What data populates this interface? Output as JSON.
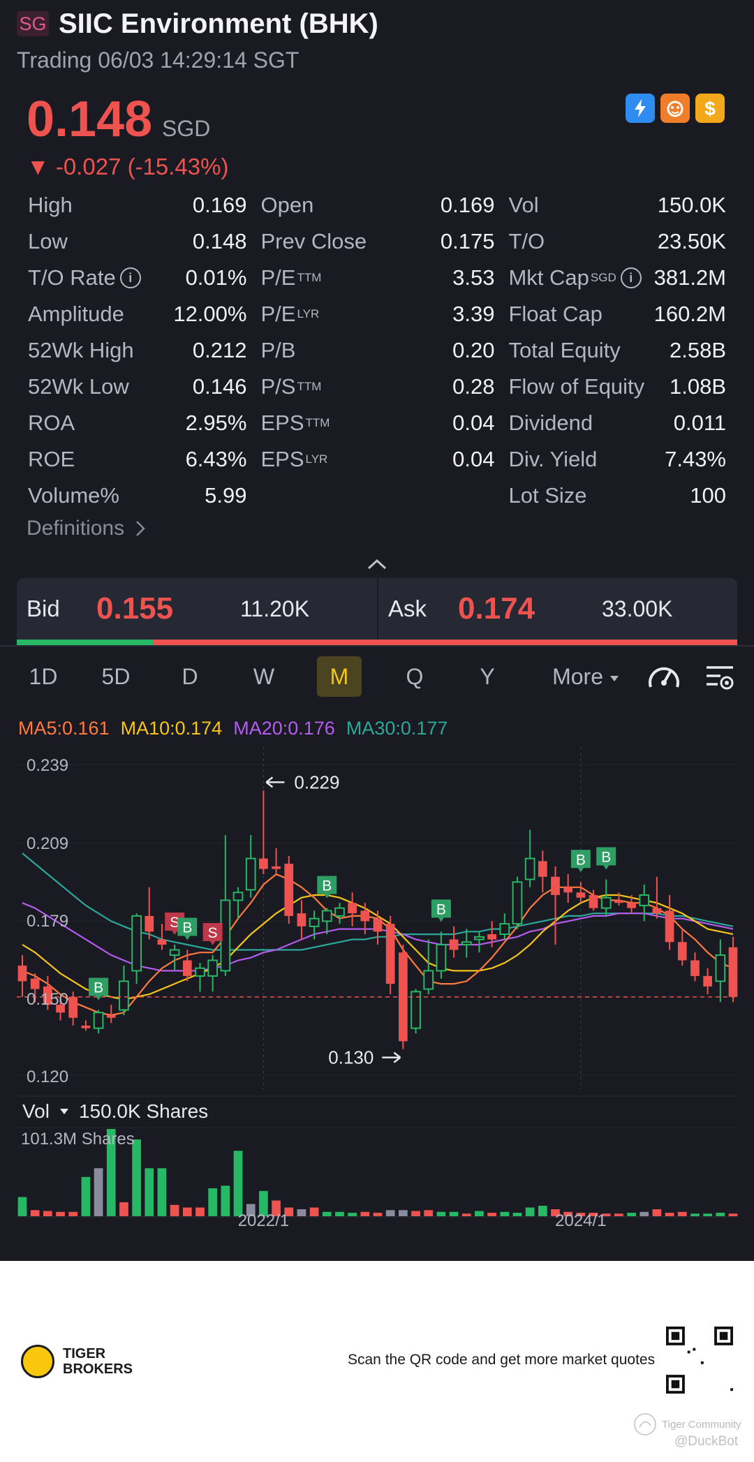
{
  "header": {
    "market_badge": "SG",
    "title": "SIIC Environment (BHK)",
    "status": "Trading 06/03 14:29:14 SGT",
    "price": "0.148",
    "currency": "SGD",
    "change": "▼ -0.027 (-15.43%)",
    "badge_icons": [
      "lightning-icon",
      "tiger-icon",
      "dollar-icon"
    ]
  },
  "stats": {
    "rows": [
      [
        {
          "label": "High",
          "value": "0.169"
        },
        {
          "label": "Open",
          "value": "0.169"
        },
        {
          "label": "Vol",
          "value": "150.0K"
        }
      ],
      [
        {
          "label": "Low",
          "value": "0.148"
        },
        {
          "label": "Prev Close",
          "value": "0.175"
        },
        {
          "label": "T/O",
          "value": "23.50K"
        }
      ],
      [
        {
          "label": "T/O Rate",
          "value": "0.01%",
          "info": true
        },
        {
          "label": "P/E",
          "sup": "TTM",
          "value": "3.53"
        },
        {
          "label": "Mkt Cap",
          "sup": "SGD",
          "value": "381.2M",
          "info": true
        }
      ],
      [
        {
          "label": "Amplitude",
          "value": "12.00%"
        },
        {
          "label": "P/E",
          "sup": "LYR",
          "value": "3.39"
        },
        {
          "label": "Float Cap",
          "value": "160.2M"
        }
      ],
      [
        {
          "label": "52Wk High",
          "value": "0.212"
        },
        {
          "label": "P/B",
          "value": "0.20"
        },
        {
          "label": "Total Equity",
          "value": "2.58B"
        }
      ],
      [
        {
          "label": "52Wk Low",
          "value": "0.146"
        },
        {
          "label": "P/S",
          "sup": "TTM",
          "value": "0.28"
        },
        {
          "label": "Flow of Equity",
          "value": "1.08B"
        }
      ],
      [
        {
          "label": "ROA",
          "value": "2.95%"
        },
        {
          "label": "EPS",
          "sup": "TTM",
          "value": "0.04"
        },
        {
          "label": "Dividend",
          "value": "0.011"
        }
      ],
      [
        {
          "label": "ROE",
          "value": "6.43%"
        },
        {
          "label": "EPS",
          "sup": "LYR",
          "value": "0.04"
        },
        {
          "label": "Div. Yield",
          "value": "7.43%"
        }
      ],
      [
        {
          "label": "Volume%",
          "value": "5.99"
        },
        {
          "label": "",
          "value": ""
        },
        {
          "label": "Lot Size",
          "value": "100"
        }
      ]
    ],
    "definitions_label": "Definitions"
  },
  "bid_ask": {
    "bid_label": "Bid",
    "bid_price": "0.155",
    "bid_size": "11.20K",
    "ask_label": "Ask",
    "ask_price": "0.174",
    "ask_size": "33.00K",
    "bid_ratio": 0.19
  },
  "tabs": {
    "items": [
      "1D",
      "5D",
      "D",
      "W",
      "M",
      "Q",
      "Y"
    ],
    "active": "M",
    "more_label": "More"
  },
  "ma_legend": [
    {
      "label": "MA5:0.161",
      "color": "#ff7a3d"
    },
    {
      "label": "MA10:0.174",
      "color": "#f5c518"
    },
    {
      "label": "MA20:0.176",
      "color": "#b45cf0"
    },
    {
      "label": "MA30:0.177",
      "color": "#2aa89a"
    }
  ],
  "chart": {
    "y_ticks": [
      "0.239",
      "0.209",
      "0.179",
      "0.150",
      "0.120"
    ],
    "max_label": "0.229",
    "min_label": "0.130",
    "x_ticks": [
      "2022/1",
      "2024/1"
    ],
    "vol_label": "Vol",
    "vol_current": "150.0K Shares",
    "vol_max": "101.3M Shares",
    "up_color": "#26b865",
    "down_color": "#ef5350",
    "buy_marker": "B",
    "sell_marker": "S"
  },
  "chart_data": {
    "type": "candlestick",
    "price_range": [
      0.12,
      0.239
    ],
    "last_price": 0.15,
    "candles": [
      {
        "o": 0.162,
        "h": 0.166,
        "l": 0.15,
        "c": 0.156
      },
      {
        "o": 0.157,
        "h": 0.159,
        "l": 0.148,
        "c": 0.153
      },
      {
        "o": 0.154,
        "h": 0.158,
        "l": 0.145,
        "c": 0.147
      },
      {
        "o": 0.147,
        "h": 0.15,
        "l": 0.141,
        "c": 0.144
      },
      {
        "o": 0.15,
        "h": 0.152,
        "l": 0.139,
        "c": 0.142
      },
      {
        "o": 0.139,
        "h": 0.141,
        "l": 0.137,
        "c": 0.138
      },
      {
        "o": 0.138,
        "h": 0.145,
        "l": 0.136,
        "c": 0.144
      },
      {
        "o": 0.143,
        "h": 0.147,
        "l": 0.14,
        "c": 0.142
      },
      {
        "o": 0.145,
        "h": 0.162,
        "l": 0.143,
        "c": 0.156
      },
      {
        "o": 0.16,
        "h": 0.182,
        "l": 0.155,
        "c": 0.181
      },
      {
        "o": 0.181,
        "h": 0.192,
        "l": 0.172,
        "c": 0.175
      },
      {
        "o": 0.172,
        "h": 0.178,
        "l": 0.168,
        "c": 0.17
      },
      {
        "o": 0.166,
        "h": 0.17,
        "l": 0.16,
        "c": 0.168
      },
      {
        "o": 0.164,
        "h": 0.168,
        "l": 0.156,
        "c": 0.158
      },
      {
        "o": 0.158,
        "h": 0.163,
        "l": 0.152,
        "c": 0.161
      },
      {
        "o": 0.158,
        "h": 0.166,
        "l": 0.152,
        "c": 0.164
      },
      {
        "o": 0.16,
        "h": 0.212,
        "l": 0.158,
        "c": 0.187
      },
      {
        "o": 0.187,
        "h": 0.192,
        "l": 0.18,
        "c": 0.19
      },
      {
        "o": 0.191,
        "h": 0.212,
        "l": 0.188,
        "c": 0.203
      },
      {
        "o": 0.203,
        "h": 0.229,
        "l": 0.197,
        "c": 0.199
      },
      {
        "o": 0.2,
        "h": 0.207,
        "l": 0.197,
        "c": 0.199
      },
      {
        "o": 0.201,
        "h": 0.204,
        "l": 0.178,
        "c": 0.181
      },
      {
        "o": 0.182,
        "h": 0.187,
        "l": 0.172,
        "c": 0.177
      },
      {
        "o": 0.177,
        "h": 0.183,
        "l": 0.172,
        "c": 0.18
      },
      {
        "o": 0.179,
        "h": 0.184,
        "l": 0.174,
        "c": 0.183
      },
      {
        "o": 0.181,
        "h": 0.186,
        "l": 0.178,
        "c": 0.184
      },
      {
        "o": 0.186,
        "h": 0.19,
        "l": 0.177,
        "c": 0.182
      },
      {
        "o": 0.183,
        "h": 0.186,
        "l": 0.174,
        "c": 0.179
      },
      {
        "o": 0.18,
        "h": 0.183,
        "l": 0.17,
        "c": 0.175
      },
      {
        "o": 0.178,
        "h": 0.181,
        "l": 0.151,
        "c": 0.155
      },
      {
        "o": 0.167,
        "h": 0.17,
        "l": 0.13,
        "c": 0.133
      },
      {
        "o": 0.138,
        "h": 0.153,
        "l": 0.136,
        "c": 0.152
      },
      {
        "o": 0.153,
        "h": 0.172,
        "l": 0.151,
        "c": 0.16
      },
      {
        "o": 0.16,
        "h": 0.175,
        "l": 0.157,
        "c": 0.17
      },
      {
        "o": 0.172,
        "h": 0.177,
        "l": 0.165,
        "c": 0.168
      },
      {
        "o": 0.17,
        "h": 0.176,
        "l": 0.165,
        "c": 0.171
      },
      {
        "o": 0.172,
        "h": 0.175,
        "l": 0.167,
        "c": 0.173
      },
      {
        "o": 0.174,
        "h": 0.179,
        "l": 0.169,
        "c": 0.172
      },
      {
        "o": 0.174,
        "h": 0.182,
        "l": 0.172,
        "c": 0.178
      },
      {
        "o": 0.178,
        "h": 0.196,
        "l": 0.176,
        "c": 0.194
      },
      {
        "o": 0.195,
        "h": 0.214,
        "l": 0.192,
        "c": 0.203
      },
      {
        "o": 0.202,
        "h": 0.206,
        "l": 0.19,
        "c": 0.196
      },
      {
        "o": 0.196,
        "h": 0.2,
        "l": 0.17,
        "c": 0.189
      },
      {
        "o": 0.192,
        "h": 0.197,
        "l": 0.186,
        "c": 0.19
      },
      {
        "o": 0.19,
        "h": 0.194,
        "l": 0.186,
        "c": 0.188
      },
      {
        "o": 0.189,
        "h": 0.191,
        "l": 0.183,
        "c": 0.184
      },
      {
        "o": 0.184,
        "h": 0.195,
        "l": 0.181,
        "c": 0.188
      },
      {
        "o": 0.187,
        "h": 0.19,
        "l": 0.185,
        "c": 0.186
      },
      {
        "o": 0.186,
        "h": 0.189,
        "l": 0.182,
        "c": 0.184
      },
      {
        "o": 0.185,
        "h": 0.193,
        "l": 0.179,
        "c": 0.189
      },
      {
        "o": 0.184,
        "h": 0.196,
        "l": 0.18,
        "c": 0.182
      },
      {
        "o": 0.183,
        "h": 0.189,
        "l": 0.168,
        "c": 0.171
      },
      {
        "o": 0.171,
        "h": 0.176,
        "l": 0.162,
        "c": 0.164
      },
      {
        "o": 0.164,
        "h": 0.167,
        "l": 0.156,
        "c": 0.158
      },
      {
        "o": 0.158,
        "h": 0.161,
        "l": 0.151,
        "c": 0.154
      },
      {
        "o": 0.156,
        "h": 0.172,
        "l": 0.148,
        "c": 0.166
      },
      {
        "o": 0.169,
        "h": 0.173,
        "l": 0.148,
        "c": 0.15
      }
    ],
    "signals": [
      {
        "i": 6,
        "type": "B"
      },
      {
        "i": 12,
        "type": "S"
      },
      {
        "i": 13,
        "type": "B"
      },
      {
        "i": 15,
        "type": "S"
      },
      {
        "i": 24,
        "type": "B"
      },
      {
        "i": 33,
        "type": "B"
      },
      {
        "i": 44,
        "type": "B"
      },
      {
        "i": 46,
        "type": "B"
      }
    ],
    "ma5": [
      0.16,
      0.158,
      0.155,
      0.151,
      0.148,
      0.146,
      0.144,
      0.143,
      0.144,
      0.15,
      0.156,
      0.161,
      0.164,
      0.166,
      0.167,
      0.167,
      0.173,
      0.18,
      0.186,
      0.193,
      0.197,
      0.195,
      0.192,
      0.188,
      0.183,
      0.18,
      0.181,
      0.181,
      0.18,
      0.176,
      0.168,
      0.162,
      0.156,
      0.155,
      0.155,
      0.156,
      0.16,
      0.165,
      0.171,
      0.177,
      0.184,
      0.189,
      0.192,
      0.192,
      0.192,
      0.189,
      0.187,
      0.187,
      0.186,
      0.186,
      0.184,
      0.181,
      0.176,
      0.172,
      0.167,
      0.163,
      0.161
    ],
    "ma10": [
      0.17,
      0.167,
      0.163,
      0.159,
      0.156,
      0.153,
      0.151,
      0.15,
      0.149,
      0.15,
      0.151,
      0.153,
      0.155,
      0.157,
      0.159,
      0.161,
      0.164,
      0.169,
      0.174,
      0.178,
      0.182,
      0.185,
      0.188,
      0.189,
      0.189,
      0.188,
      0.186,
      0.184,
      0.181,
      0.178,
      0.173,
      0.168,
      0.163,
      0.161,
      0.16,
      0.16,
      0.16,
      0.161,
      0.163,
      0.166,
      0.17,
      0.175,
      0.179,
      0.183,
      0.186,
      0.188,
      0.189,
      0.189,
      0.188,
      0.187,
      0.186,
      0.184,
      0.182,
      0.179,
      0.176,
      0.175,
      0.174
    ],
    "ma20": [
      0.186,
      0.184,
      0.181,
      0.178,
      0.175,
      0.172,
      0.169,
      0.166,
      0.164,
      0.162,
      0.161,
      0.16,
      0.16,
      0.16,
      0.16,
      0.161,
      0.162,
      0.164,
      0.165,
      0.167,
      0.168,
      0.17,
      0.172,
      0.174,
      0.175,
      0.176,
      0.176,
      0.176,
      0.176,
      0.175,
      0.174,
      0.172,
      0.171,
      0.17,
      0.17,
      0.17,
      0.17,
      0.171,
      0.172,
      0.173,
      0.175,
      0.176,
      0.178,
      0.179,
      0.18,
      0.181,
      0.181,
      0.182,
      0.182,
      0.182,
      0.181,
      0.18,
      0.18,
      0.179,
      0.178,
      0.177,
      0.176
    ],
    "ma30": [
      0.205,
      0.201,
      0.197,
      0.193,
      0.189,
      0.185,
      0.182,
      0.179,
      0.177,
      0.175,
      0.174,
      0.172,
      0.171,
      0.17,
      0.169,
      0.168,
      0.168,
      0.168,
      0.168,
      0.168,
      0.168,
      0.168,
      0.168,
      0.169,
      0.17,
      0.171,
      0.172,
      0.172,
      0.173,
      0.173,
      0.174,
      0.174,
      0.174,
      0.174,
      0.174,
      0.175,
      0.175,
      0.176,
      0.176,
      0.177,
      0.178,
      0.179,
      0.18,
      0.181,
      0.181,
      0.182,
      0.182,
      0.182,
      0.182,
      0.182,
      0.182,
      0.181,
      0.181,
      0.18,
      0.179,
      0.178,
      0.177
    ],
    "volume_max_label": "101.3M Shares",
    "volumes": [
      0.22,
      0.07,
      0.06,
      0.05,
      0.05,
      0.45,
      0.55,
      1.0,
      0.16,
      0.88,
      0.55,
      0.55,
      0.13,
      0.1,
      0.1,
      0.32,
      0.35,
      0.75,
      0.14,
      0.29,
      0.18,
      0.1,
      0.08,
      0.1,
      0.05,
      0.05,
      0.04,
      0.05,
      0.04,
      0.07,
      0.07,
      0.06,
      0.07,
      0.05,
      0.05,
      0.03,
      0.06,
      0.04,
      0.05,
      0.04,
      0.1,
      0.12,
      0.08,
      0.05,
      0.04,
      0.04,
      0.03,
      0.03,
      0.04,
      0.05,
      0.08,
      0.04,
      0.05,
      0.03,
      0.03,
      0.04,
      0.03
    ],
    "volume_dir": [
      "up",
      "down",
      "down",
      "down",
      "down",
      "up",
      "flat",
      "up",
      "down",
      "up",
      "up",
      "up",
      "down",
      "down",
      "down",
      "up",
      "up",
      "up",
      "flat",
      "up",
      "down",
      "down",
      "flat",
      "down",
      "up",
      "up",
      "up",
      "down",
      "down",
      "flat",
      "flat",
      "down",
      "down",
      "up",
      "up",
      "down",
      "up",
      "down",
      "up",
      "up",
      "up",
      "up",
      "down",
      "down",
      "down",
      "down",
      "down",
      "down",
      "up",
      "flat",
      "down",
      "down",
      "down",
      "up",
      "up",
      "up",
      "down"
    ],
    "x_tick_index": [
      {
        "label": "2022/1",
        "i": 19
      },
      {
        "label": "2024/1",
        "i": 44
      }
    ]
  },
  "footer": {
    "brand_line1": "TIGER",
    "brand_line2": "BROKERS",
    "scan_text": "Scan the QR code and get more market quotes",
    "community": "Tiger Community",
    "watermark": "@DuckBot"
  }
}
